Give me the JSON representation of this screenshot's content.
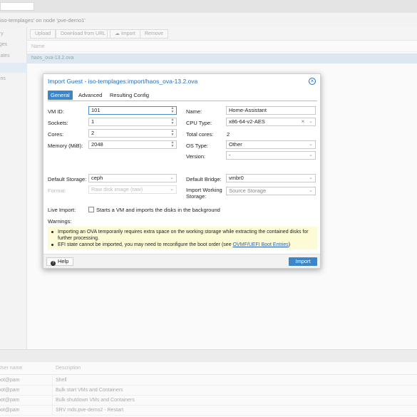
{
  "background": {
    "panel_title": "iso-templages' on node 'pve-demo1'",
    "nav_items": [
      "ary",
      "ages",
      "plates",
      "",
      "ions"
    ],
    "toolbar": {
      "upload": "Upload",
      "download_url": "Download from URL",
      "import": "Import",
      "remove": "Remove"
    },
    "column_name": "Name",
    "selected_file": "haos_ova-13.2.ova",
    "tasks": {
      "headers": [
        "User name",
        "Description"
      ],
      "rows": [
        [
          "oot@pam",
          "Shell"
        ],
        [
          "oot@pam",
          "Bulk start VMs and Containers"
        ],
        [
          "oot@pam",
          "Bulk shutdown VMs and Containers"
        ],
        [
          "oot@pam",
          "SRV mds.pve-demo2 - Restart"
        ]
      ]
    }
  },
  "dialog": {
    "title": "Import Guest - iso-templages:import/haos_ova-13.2.ova",
    "tabs": [
      "General",
      "Advanced",
      "Resulting Config"
    ],
    "vm_id": {
      "label": "VM ID:",
      "value": "101"
    },
    "sockets": {
      "label": "Sockets:",
      "value": "1"
    },
    "cores": {
      "label": "Cores:",
      "value": "2"
    },
    "memory": {
      "label": "Memory (MiB):",
      "value": "2048"
    },
    "name": {
      "label": "Name:",
      "value": "Home-Assistant"
    },
    "cpu_type": {
      "label": "CPU Type:",
      "value": "x86-64-v2-AES"
    },
    "total_cores": {
      "label": "Total cores:",
      "value": "2"
    },
    "os_type": {
      "label": "OS Type:",
      "value": "Other"
    },
    "version": {
      "label": "Version:",
      "value": "-"
    },
    "default_storage": {
      "label": "Default Storage:",
      "value": "ceph"
    },
    "format": {
      "label": "Format:",
      "value": "Raw disk image (raw)"
    },
    "default_bridge": {
      "label": "Default Bridge:",
      "value": "vmbr0"
    },
    "import_working_storage": {
      "label_line1": "Import Working",
      "label_line2": "Storage:",
      "placeholder": "Source Storage"
    },
    "live_import": {
      "label": "Live Import:",
      "description": "Starts a VM and imports the disks in the background",
      "checked": false
    },
    "warnings_label": "Warnings:",
    "warnings": {
      "w1_line1": "Importing an OVA temporarily requires extra space on the working storage while extracting the contained disks for",
      "w1_line2": "further processing.",
      "w2_prefix": "EFI state cannot be imported, you may need to reconfigure the boot order (see ",
      "w2_link": "OVMF/UEFI Boot Entries",
      "w2_suffix": ")"
    },
    "help_button": "Help",
    "import_button": "Import"
  },
  "icons": {
    "close": "close-circle-icon",
    "help": "help-circle-icon",
    "dropdown": "chevron-down-icon",
    "spinner": "spinner-arrows-icon",
    "clear": "clear-x-icon",
    "upload": "cloud-upload-icon"
  },
  "colors": {
    "accent": "#3a86c8",
    "title": "#1f6fbf",
    "warning_bg": "#fdfbd6",
    "link": "#2a5db0"
  }
}
